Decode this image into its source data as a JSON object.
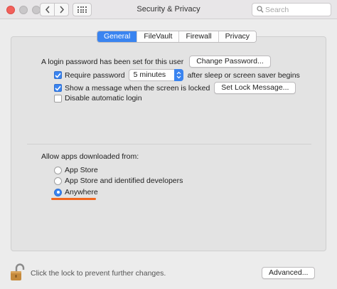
{
  "window": {
    "title": "Security & Privacy",
    "search_placeholder": "Search",
    "back_icon": "chevron-left-icon",
    "forward_icon": "chevron-right-icon",
    "grid_icon": "show-all-grid-icon"
  },
  "tabs": [
    {
      "label": "General",
      "selected": true
    },
    {
      "label": "FileVault",
      "selected": false
    },
    {
      "label": "Firewall",
      "selected": false
    },
    {
      "label": "Privacy",
      "selected": false
    }
  ],
  "general": {
    "login_text": "A login password has been set for this user",
    "change_password_label": "Change Password...",
    "require_password": {
      "label": "Require password",
      "checked": true
    },
    "require_password_delay": "5 minutes",
    "after_sleep_text": "after sleep or screen saver begins",
    "show_message": {
      "label": "Show a message when the screen is locked",
      "checked": true
    },
    "set_lock_message_label": "Set Lock Message...",
    "disable_auto_login": {
      "label": "Disable automatic login",
      "checked": false
    },
    "allow_apps_heading": "Allow apps downloaded from:",
    "allow_options": [
      {
        "label": "App Store",
        "selected": false
      },
      {
        "label": "App Store and identified developers",
        "selected": false
      },
      {
        "label": "Anywhere",
        "selected": true
      }
    ]
  },
  "footer": {
    "lock_text": "Click the lock to prevent further changes.",
    "advanced_label": "Advanced..."
  },
  "colors": {
    "accent": "#3a84f0",
    "highlight_underline": "#f2661d",
    "close_button": "#f2605b"
  }
}
